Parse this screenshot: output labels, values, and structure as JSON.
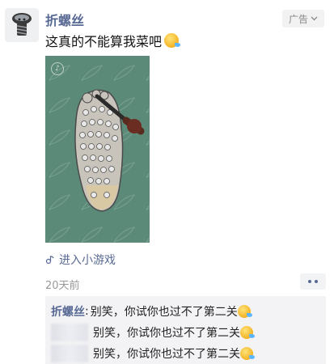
{
  "post": {
    "username": "折螺丝",
    "ad_label": "广告",
    "caption": "这真的不能算我菜吧",
    "mini_game_label": "进入小游戏",
    "timestamp": "20天前"
  },
  "comments": [
    {
      "author": "折螺丝",
      "separator": ":",
      "text": "别笑，你试你也过不了第二关"
    },
    {
      "author": "",
      "separator": "",
      "text": "别笑，你试你也过不了第二关"
    },
    {
      "author": "",
      "separator": "",
      "text": "别笑，你试你也过不了第二关"
    }
  ],
  "icons": {
    "avatar": "screw-avatar-icon",
    "ad_chevron": "chevron-down-icon",
    "emoji": "tears-of-laughter-emoji-icon",
    "mini_game": "link-icon",
    "more": "more-dots-icon"
  },
  "colors": {
    "name_blue": "#586a94",
    "media_green": "#5c8a78",
    "comment_bg": "#f3f3f5"
  }
}
